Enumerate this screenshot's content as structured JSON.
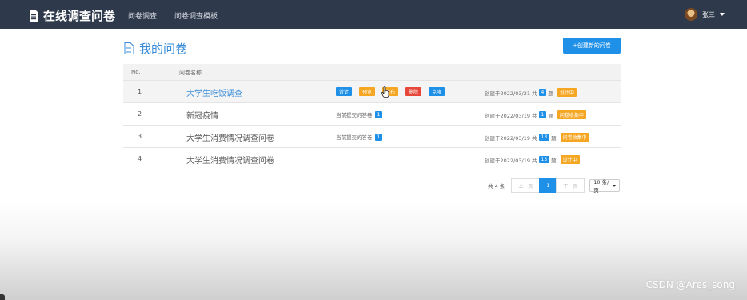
{
  "navbar": {
    "brand": "在线调查问卷",
    "links": [
      "问卷调查",
      "问卷调查模板"
    ],
    "user_name": "张三"
  },
  "page": {
    "title": "我的问卷",
    "create_button": "+创建新的问卷"
  },
  "table": {
    "headers": [
      "No.",
      "问卷名称"
    ],
    "rows": [
      {
        "no": "1",
        "name": "大学生吃饭调查",
        "actions": [
          "设计",
          "预览",
          "发布",
          "删除",
          "克隆"
        ],
        "created": "创建于2022/03/21 共",
        "q_count": "4",
        "q_unit": "题",
        "status": "设计中"
      },
      {
        "no": "2",
        "name": "新冠疫情",
        "submitted_label": "当前提交的答卷",
        "submitted_count": "1",
        "created": "创建于2022/03/19 共",
        "q_count": "1",
        "q_unit": "题",
        "status": "问卷收集中"
      },
      {
        "no": "3",
        "name": "大学生消费情况调查问卷",
        "submitted_label": "当前提交的答卷",
        "submitted_count": "1",
        "created": "创建于2022/03/19 共",
        "q_count": "13",
        "q_unit": "题",
        "status": "问卷收集中"
      },
      {
        "no": "4",
        "name": "大学生消费情况调查问卷",
        "created": "创建于2022/03/19 共",
        "q_count": "13",
        "q_unit": "题",
        "status": "设计中"
      }
    ]
  },
  "pagination": {
    "total": "共 4 条",
    "prev": "上一页",
    "current": "1",
    "next": "下一页",
    "page_size": "10 条/页"
  },
  "watermark": "CSDN @Ares_song",
  "colors": {
    "navbar": "#2e3a4b",
    "primary": "#1e90e8",
    "warning": "#f5a623",
    "danger": "#e8483a"
  }
}
